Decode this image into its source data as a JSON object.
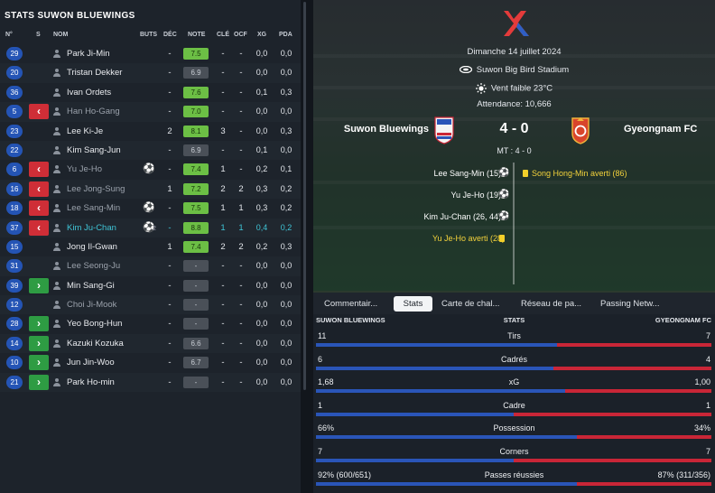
{
  "left_panel": {
    "title": "STATS SUWON BLUEWINGS",
    "headers": {
      "num": "N°",
      "sub": "S",
      "name": "NOM",
      "goals": "BUTS",
      "dec": "DÉC",
      "rating": "NOTE",
      "key": "CLÉ",
      "ocf": "OCF",
      "xg": "XG",
      "pda": "PDA"
    },
    "players": [
      {
        "num": "29",
        "sub": "",
        "name": "Park Ji-Min",
        "goals": "",
        "goal_count": "",
        "dec": "-",
        "rating": "7.5",
        "rating_color": "green",
        "key": "-",
        "ocf": "-",
        "xg": "0,0",
        "pda": "0,0",
        "style": "normal"
      },
      {
        "num": "20",
        "sub": "",
        "name": "Tristan Dekker",
        "goals": "",
        "goal_count": "",
        "dec": "-",
        "rating": "6.9",
        "rating_color": "neutral",
        "key": "-",
        "ocf": "-",
        "xg": "0,0",
        "pda": "0,0",
        "style": "normal"
      },
      {
        "num": "36",
        "sub": "",
        "name": "Ivan Ordets",
        "goals": "",
        "goal_count": "",
        "dec": "-",
        "rating": "7.6",
        "rating_color": "green",
        "key": "-",
        "ocf": "-",
        "xg": "0,1",
        "pda": "0,3",
        "style": "normal"
      },
      {
        "num": "5",
        "sub": "out",
        "name": "Han Ho-Gang",
        "goals": "",
        "goal_count": "",
        "dec": "-",
        "rating": "7.0",
        "rating_color": "green",
        "key": "-",
        "ocf": "-",
        "xg": "0,0",
        "pda": "0,0",
        "style": "dim"
      },
      {
        "num": "23",
        "sub": "",
        "name": "Lee Ki-Je",
        "goals": "",
        "goal_count": "",
        "dec": "2",
        "rating": "8.1",
        "rating_color": "green",
        "key": "3",
        "ocf": "-",
        "xg": "0,0",
        "pda": "0,3",
        "style": "normal"
      },
      {
        "num": "22",
        "sub": "",
        "name": "Kim Sang-Jun",
        "goals": "",
        "goal_count": "",
        "dec": "-",
        "rating": "6.9",
        "rating_color": "neutral",
        "key": "-",
        "ocf": "-",
        "xg": "0,1",
        "pda": "0,0",
        "style": "normal"
      },
      {
        "num": "6",
        "sub": "out",
        "name": "Yu Je-Ho",
        "goals": "⚽",
        "goal_count": "",
        "dec": "-",
        "rating": "7.4",
        "rating_color": "green",
        "key": "1",
        "ocf": "-",
        "xg": "0,2",
        "pda": "0,1",
        "style": "dim"
      },
      {
        "num": "16",
        "sub": "out",
        "name": "Lee Jong-Sung",
        "goals": "",
        "goal_count": "",
        "dec": "1",
        "rating": "7.2",
        "rating_color": "green",
        "key": "2",
        "ocf": "2",
        "xg": "0,3",
        "pda": "0,2",
        "style": "dim"
      },
      {
        "num": "18",
        "sub": "out",
        "name": "Lee Sang-Min",
        "goals": "⚽",
        "goal_count": "",
        "dec": "-",
        "rating": "7.5",
        "rating_color": "green",
        "key": "1",
        "ocf": "1",
        "xg": "0,3",
        "pda": "0,2",
        "style": "dim"
      },
      {
        "num": "37",
        "sub": "out",
        "name": "Kim Ju-Chan",
        "goals": "⚽",
        "goal_count": "2",
        "dec": "-",
        "rating": "8.8",
        "rating_color": "green",
        "key": "1",
        "ocf": "1",
        "xg": "0,4",
        "pda": "0,2",
        "style": "highlight"
      },
      {
        "num": "15",
        "sub": "",
        "name": "Jong Il-Gwan",
        "goals": "",
        "goal_count": "",
        "dec": "1",
        "rating": "7.4",
        "rating_color": "green",
        "key": "2",
        "ocf": "2",
        "xg": "0,2",
        "pda": "0,3",
        "style": "normal"
      },
      {
        "num": "31",
        "sub": "",
        "name": "Lee Seong-Ju",
        "goals": "",
        "goal_count": "",
        "dec": "-",
        "rating": "-",
        "rating_color": "neutral",
        "key": "-",
        "ocf": "-",
        "xg": "0,0",
        "pda": "0,0",
        "style": "dim"
      },
      {
        "num": "39",
        "sub": "in",
        "name": "Min Sang-Gi",
        "goals": "",
        "goal_count": "",
        "dec": "-",
        "rating": "-",
        "rating_color": "neutral",
        "key": "-",
        "ocf": "-",
        "xg": "0,0",
        "pda": "0,0",
        "style": "normal"
      },
      {
        "num": "12",
        "sub": "",
        "name": "Choi Ji-Mook",
        "goals": "",
        "goal_count": "",
        "dec": "-",
        "rating": "-",
        "rating_color": "neutral",
        "key": "-",
        "ocf": "-",
        "xg": "0,0",
        "pda": "0,0",
        "style": "dim"
      },
      {
        "num": "28",
        "sub": "in",
        "name": "Yeo Bong-Hun",
        "goals": "",
        "goal_count": "",
        "dec": "-",
        "rating": "-",
        "rating_color": "neutral",
        "key": "-",
        "ocf": "-",
        "xg": "0,0",
        "pda": "0,0",
        "style": "normal"
      },
      {
        "num": "14",
        "sub": "in",
        "name": "Kazuki Kozuka",
        "goals": "",
        "goal_count": "",
        "dec": "-",
        "rating": "6.6",
        "rating_color": "neutral",
        "key": "-",
        "ocf": "-",
        "xg": "0,0",
        "pda": "0,0",
        "style": "normal"
      },
      {
        "num": "10",
        "sub": "in",
        "name": "Jun Jin-Woo",
        "goals": "",
        "goal_count": "",
        "dec": "-",
        "rating": "6.7",
        "rating_color": "neutral",
        "key": "-",
        "ocf": "-",
        "xg": "0,0",
        "pda": "0,0",
        "style": "normal"
      },
      {
        "num": "21",
        "sub": "in",
        "name": "Park Ho-min",
        "goals": "",
        "goal_count": "",
        "dec": "-",
        "rating": "-",
        "rating_color": "neutral",
        "key": "-",
        "ocf": "-",
        "xg": "0,0",
        "pda": "0,0",
        "style": "normal"
      }
    ]
  },
  "match": {
    "date": "Dimanche 14 juillet 2024",
    "stadium": "Suwon Big Bird Stadium",
    "weather": "Vent faible 23°C",
    "attendance": "Attendance: 10,666",
    "home_team": "Suwon Bluewings",
    "away_team": "Gyeongnam FC",
    "score": "4 - 0",
    "halftime": "MT : 4 - 0",
    "events_home": [
      {
        "text": "Lee Sang-Min (15)",
        "type": "goal"
      },
      {
        "text": "Yu Je-Ho (19)",
        "type": "goal"
      },
      {
        "text": "Kim Ju-Chan (26, 44)",
        "type": "goal"
      },
      {
        "text": "Yu Je-Ho averti (28)",
        "type": "yellow"
      }
    ],
    "events_away": [
      {
        "text": "Song Hong-Min averti (86)",
        "type": "yellow"
      }
    ],
    "colors": {
      "home": "#2a55b8",
      "away": "#c92637",
      "accent_green": "#6cbf45",
      "sub_out": "#cf2e37",
      "sub_in": "#2e9c43",
      "highlight": "#3fc4d6"
    }
  },
  "tabs": [
    "Commentair...",
    "Stats",
    "Carte de chal...",
    "Réseau de pa...",
    "Passing Netw..."
  ],
  "active_tab": "Stats",
  "stats": {
    "home_label": "SUWON BLUEWINGS",
    "center_label": "STATS",
    "away_label": "GYEONGNAM FC",
    "rows": [
      {
        "label": "Tirs",
        "home": "11",
        "away": "7",
        "home_share": 0.61
      },
      {
        "label": "Cadrés",
        "home": "6",
        "away": "4",
        "home_share": 0.6
      },
      {
        "label": "xG",
        "home": "1,68",
        "away": "1,00",
        "home_share": 0.63
      },
      {
        "label": "Cadre",
        "home": "1",
        "away": "1",
        "home_share": 0.5
      },
      {
        "label": "Possession",
        "home": "66%",
        "away": "34%",
        "home_share": 0.66
      },
      {
        "label": "Corners",
        "home": "7",
        "away": "7",
        "home_share": 0.5
      },
      {
        "label": "Passes réussies",
        "home": "92% (600/651)",
        "away": "87% (311/356)",
        "home_share": 0.66
      }
    ]
  }
}
